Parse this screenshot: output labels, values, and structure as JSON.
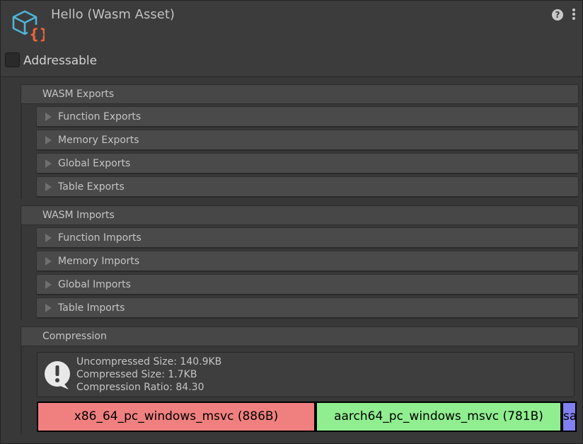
{
  "header": {
    "title": "Hello (Wasm Asset)",
    "help_icon": "question-circle-icon",
    "menu_icon": "vertical-ellipsis-icon",
    "asset_icon": "cube-with-braces-icon",
    "addressable_label": "Addressable",
    "addressable_checked": false
  },
  "exports": {
    "label": "WASM Exports",
    "items": [
      "Function Exports",
      "Memory Exports",
      "Global Exports",
      "Table Exports"
    ]
  },
  "imports": {
    "label": "WASM Imports",
    "items": [
      "Function Imports",
      "Memory Imports",
      "Global Imports",
      "Table Imports"
    ]
  },
  "compression": {
    "label": "Compression",
    "info_icon": "exclamation-speech-bubble-icon",
    "lines": [
      "Uncompressed Size: 140.9KB",
      "Compressed Size: 1.7KB",
      "Compression Ratio: 84.30"
    ],
    "segments": [
      {
        "label": "x86_64_pc_windows_msvc (886B)",
        "color": "#f08080"
      },
      {
        "label": "aarch64_pc_windows_msvc (781B)",
        "color": "#90ee90"
      },
      {
        "label": "sa",
        "color": "#8080f0"
      }
    ]
  },
  "colors": {
    "panel_bg": "#383838",
    "header_bg": "#474747",
    "foldout_bg": "#4a4a4a",
    "icon_blue": "#4fb4d8",
    "icon_orange": "#e8643a"
  }
}
